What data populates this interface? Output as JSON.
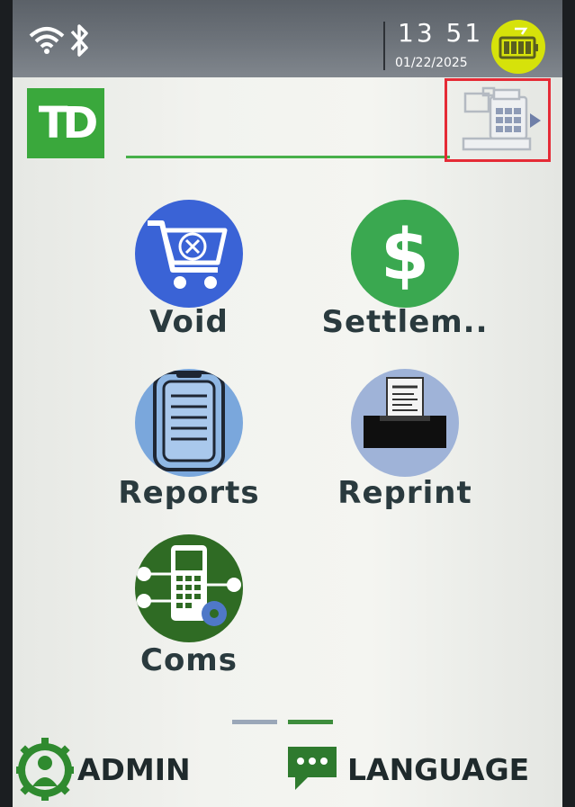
{
  "status": {
    "time": "13 51",
    "date": "01/22/2025",
    "icons": [
      "wifi-icon",
      "bluetooth-icon",
      "battery-icon"
    ]
  },
  "header": {
    "logo_text": "TD",
    "register_icon": "cash-register-icon"
  },
  "menu": [
    {
      "label": "Void",
      "icon": "shopping-cart-cancel-icon",
      "color": "#3a63d6"
    },
    {
      "label": "Settlem..",
      "icon": "dollar-icon",
      "color": "#3aa850"
    },
    {
      "label": "Reports",
      "icon": "clipboard-icon",
      "color": "#7aa7dc"
    },
    {
      "label": "Reprint",
      "icon": "printer-receipt-icon",
      "color": "#9fb3d8"
    },
    {
      "label": "Coms",
      "icon": "terminal-network-icon",
      "color": "#2f6b24"
    }
  ],
  "pager": {
    "pages": 2,
    "current": 2
  },
  "footer": {
    "admin_label": "ADMIN",
    "language_label": "LANGUAGE"
  },
  "colors": {
    "brand_green": "#3aa83c",
    "highlight_red": "#e52b36"
  }
}
